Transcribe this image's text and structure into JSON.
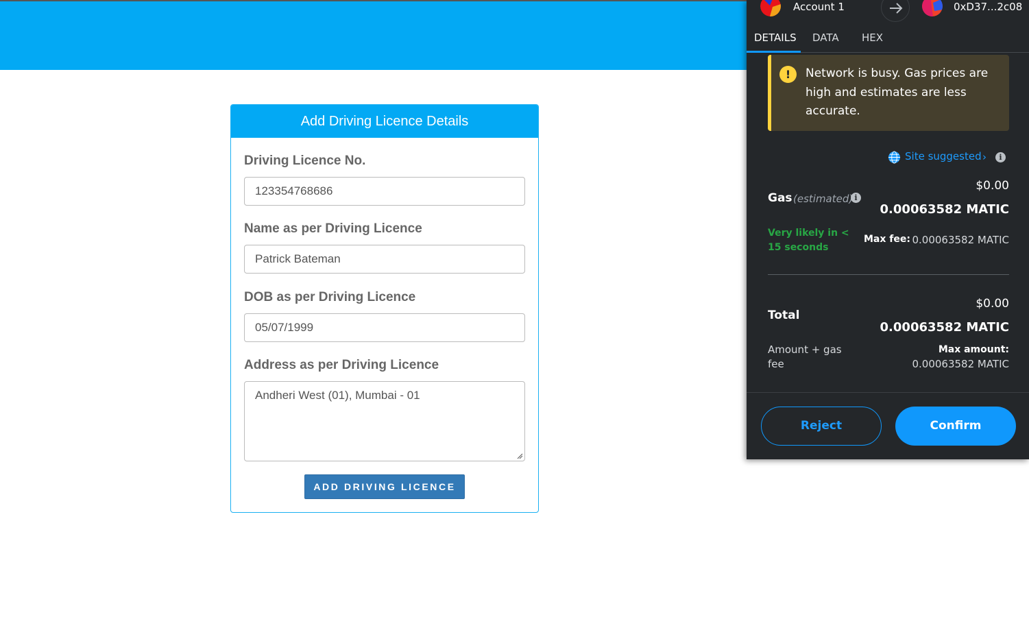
{
  "form": {
    "title": "Add Driving Licence Details",
    "licence_no_label": "Driving Licence No.",
    "licence_no_value": "123354768686",
    "name_label": "Name as per Driving Licence",
    "name_value": "Patrick Bateman",
    "dob_label": "DOB as per Driving Licence",
    "dob_value": "05/07/1999",
    "address_label": "Address as per Driving Licence",
    "address_value": "Andheri West (01), Mumbai - 01",
    "submit_label": "ADD DRIVING LICENCE"
  },
  "metamask": {
    "account_name": "Account 1",
    "to_address": "0xD37...2c08",
    "tabs": [
      "DETAILS",
      "DATA",
      "HEX"
    ],
    "active_tab": "DETAILS",
    "warning": "Network is busy. Gas prices are high and estimates are less accurate.",
    "site_suggested": "Site suggested",
    "gas_label": "Gas",
    "gas_estimated": "(estimated)",
    "gas_usd": "$0.00",
    "gas_matic": "0.00063582 MATIC",
    "likely": "Very likely in < 15 seconds",
    "max_fee_label": "Max fee:",
    "max_fee_value": "0.00063582 MATIC",
    "total_label": "Total",
    "total_usd": "$0.00",
    "total_matic": "0.00063582 MATIC",
    "amount_gas_label": "Amount + gas fee",
    "max_amount_label": "Max amount:",
    "max_amount_value": "0.00063582 MATIC",
    "reject_label": "Reject",
    "confirm_label": "Confirm"
  },
  "colors": {
    "header_blue": "#03a9f4",
    "button_blue": "#337ab7",
    "metamask_bg": "#24272a",
    "metamask_accent": "#1098fc",
    "warning_yellow": "#ffd33d",
    "success_green": "#28a745"
  }
}
